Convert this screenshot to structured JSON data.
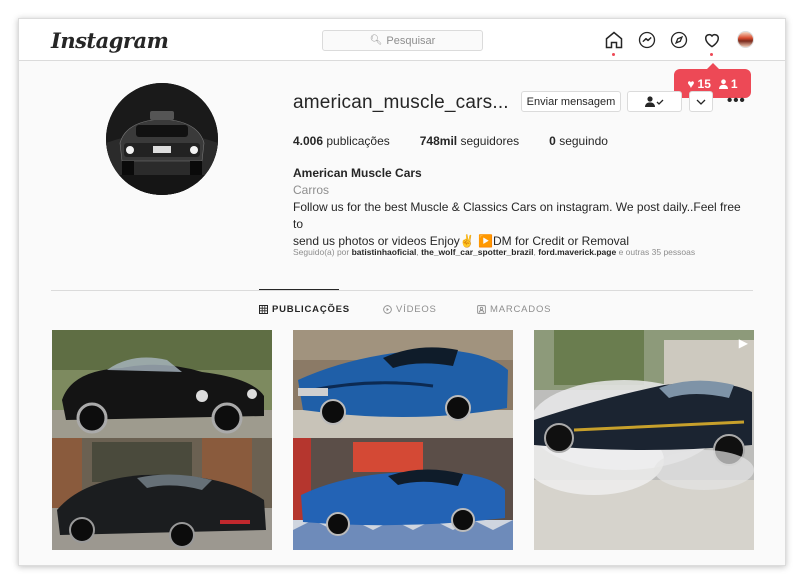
{
  "header": {
    "logo": "Instagram",
    "search_placeholder": "Pesquisar",
    "nav_icons": [
      "home-icon",
      "messenger-icon",
      "explore-icon",
      "heart-icon",
      "profile-avatar"
    ]
  },
  "notifications": {
    "likes": "15",
    "followers": "1"
  },
  "profile": {
    "username": "american_muscle_cars...",
    "message_button": "Enviar mensagem",
    "stats": [
      {
        "value": "4.006",
        "label": "publicações"
      },
      {
        "value": "748mil",
        "label": "seguidores"
      },
      {
        "value": "0",
        "label": "seguindo"
      }
    ],
    "full_name": "American Muscle Cars",
    "category": "Carros",
    "bio_line1": "Follow us for the best Muscle & Classics Cars on instagram. We post daily..Feel free to",
    "bio_line2": "send us photos or videos Enjoy✌️ ▶️DM for Credit or Removal",
    "followed_by_prefix": "Seguido(a) por",
    "followed_by_users": [
      "batistinhaoficial",
      "the_wolf_car_spotter_brazil",
      "ford.maverick.page"
    ],
    "followed_by_suffix": "e outras 35 pessoas"
  },
  "tabs": [
    {
      "label": "PUBLICAÇÕES",
      "icon": "grid-icon",
      "active": true
    },
    {
      "label": "VÍDEOS",
      "icon": "play-circle-icon",
      "active": false
    },
    {
      "label": "MARCADOS",
      "icon": "tag-icon",
      "active": false
    }
  ],
  "posts": [
    {
      "description": "black-cobra-and-corvette"
    },
    {
      "description": "blue-coronet-and-gto"
    },
    {
      "description": "mustang-burnout-video",
      "video": true
    }
  ],
  "colors": {
    "accent": "#ed4956",
    "text": "#262626",
    "muted": "#8e8e8e",
    "border": "#dbdbdb"
  }
}
